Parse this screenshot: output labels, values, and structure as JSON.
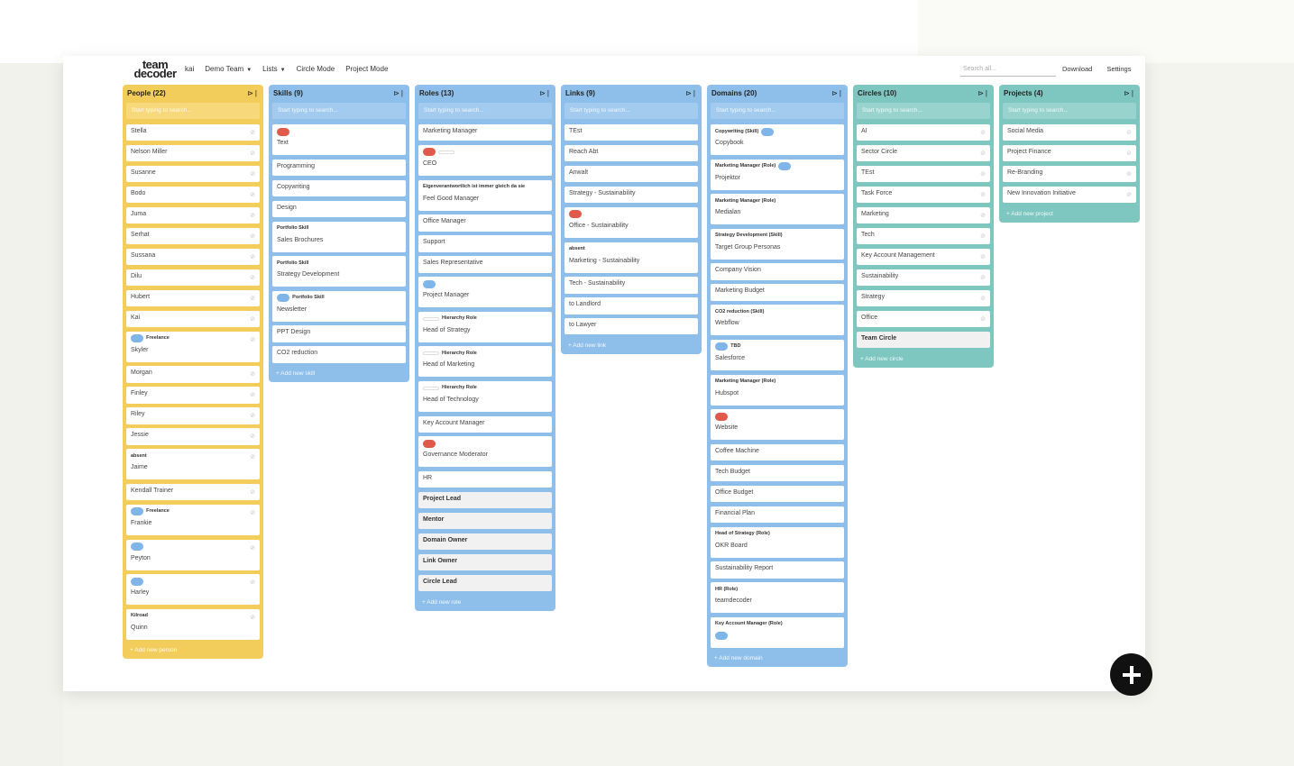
{
  "header": {
    "logo_top": "team",
    "logo_bottom": "decoder",
    "user": "kai",
    "team": "Demo Team",
    "lists": "Lists",
    "circle_mode": "Circle Mode",
    "project_mode": "Project Mode",
    "search_placeholder": "Search all...",
    "download": "Download",
    "settings": "Settings"
  },
  "colors": {
    "people": "#f3cd5b",
    "skills": "#8ebfea",
    "circles": "#7ec7c1",
    "red_tag": "#e05a4c",
    "blue_tag": "#7fb5e8"
  },
  "columns": {
    "people": {
      "title": "People (22)",
      "search": "Start typing to search...",
      "footer": "+ Add new person",
      "items": [
        "Stella",
        "Nelson Miller",
        "Susanne",
        "Bodo",
        "Juma",
        "Serhat",
        "Sussana",
        "Dilu",
        "Hubert",
        "Kai",
        "Skyler",
        "Morgan",
        "Finley",
        "Riley",
        "Jessie",
        "Jaime",
        "Kendall Trainer",
        "Frankie",
        "Peyton",
        "Harley",
        "Quinn"
      ],
      "tags": {
        "freelance": "Freelance",
        "absent": "absent",
        "kilroad": "Kilroad"
      }
    },
    "skills": {
      "title": "Skills (9)",
      "search": "Start typing to search...",
      "footer": "+ Add new skill",
      "items": [
        "Text",
        "Programming",
        "Copywriting",
        "Design",
        "Sales Brochures",
        "Strategy Development",
        "Newsletter",
        "PPT Design",
        "CO2 reduction"
      ],
      "tags": {
        "portfolio_skill": "Portfolio Skill"
      }
    },
    "roles": {
      "title": "Roles (13)",
      "search": "Start typing to search...",
      "footer": "+ Add new role",
      "items": [
        "Marketing Manager",
        "CEO",
        "Feel Good Manager",
        "Office Manager",
        "Support",
        "Sales Representative",
        "Project Manager",
        "Head of Strategy",
        "Head of Marketing",
        "Head of Technology",
        "Key Account Manager",
        "Governance Moderator",
        "HR",
        "Project Lead",
        "Mentor",
        "Domain Owner",
        "Link Owner",
        "Circle Lead"
      ],
      "tags": {
        "hierarchy": "Hierarchy Role",
        "feel_good": "Eigenverantwortlich ist immer gleich da sie"
      }
    },
    "links": {
      "title": "Links (9)",
      "search": "Start typing to search...",
      "footer": "+ Add new link",
      "items": [
        "TEst",
        "Reach Abt",
        "Anwalt",
        "Strategy - Sustainability",
        "Office - Sustainability",
        "Marketing - Sustainability",
        "Tech - Sustainability",
        "to Landlord",
        "to Lawyer"
      ],
      "tags": {
        "absent": "absent"
      }
    },
    "domains": {
      "title": "Domains (20)",
      "search": "Start typing to search...",
      "footer": "+ Add new domain",
      "items": [
        "Copybook",
        "Projektor",
        "Medialan",
        "Target Group Personas",
        "Company Vision",
        "Marketing Budget",
        "Webflow",
        "Salesforce",
        "Hubspot",
        "Website",
        "Coffee Machine",
        "Tech Budget",
        "Office Budget",
        "Financial Plan",
        "OKR Board",
        "Sustainability Report",
        "teamdecoder"
      ],
      "tags": {
        "copywriting": "Copywriting (Skill)",
        "mm_role": "Marketing Manager (Role)",
        "strategy_dev": "Strategy Development (Skill)",
        "co2": "CO2 reduction (Skill)",
        "tbd": "TBD",
        "hos": "Head of Strategy (Role)",
        "hr": "HR (Role)",
        "kam": "Key Account Manager (Role)"
      }
    },
    "circles": {
      "title": "Circles (10)",
      "search": "Start typing to search...",
      "footer": "+ Add new circle",
      "items": [
        "AI",
        "Sector Circle",
        "TEst",
        "Task Force",
        "Marketing",
        "Tech",
        "Key Account Management",
        "Sustainability",
        "Strategy",
        "Office",
        "Team Circle"
      ]
    },
    "projects": {
      "title": "Projects (4)",
      "search": "Start typing to search...",
      "footer": "+ Add new project",
      "items": [
        "Social Media",
        "Project Finance",
        "Re-Branding",
        "New Innovation Initiative"
      ]
    }
  },
  "icons": {
    "fab": "plus-icon",
    "pin": "pin-icon",
    "card": "edit-icon"
  }
}
